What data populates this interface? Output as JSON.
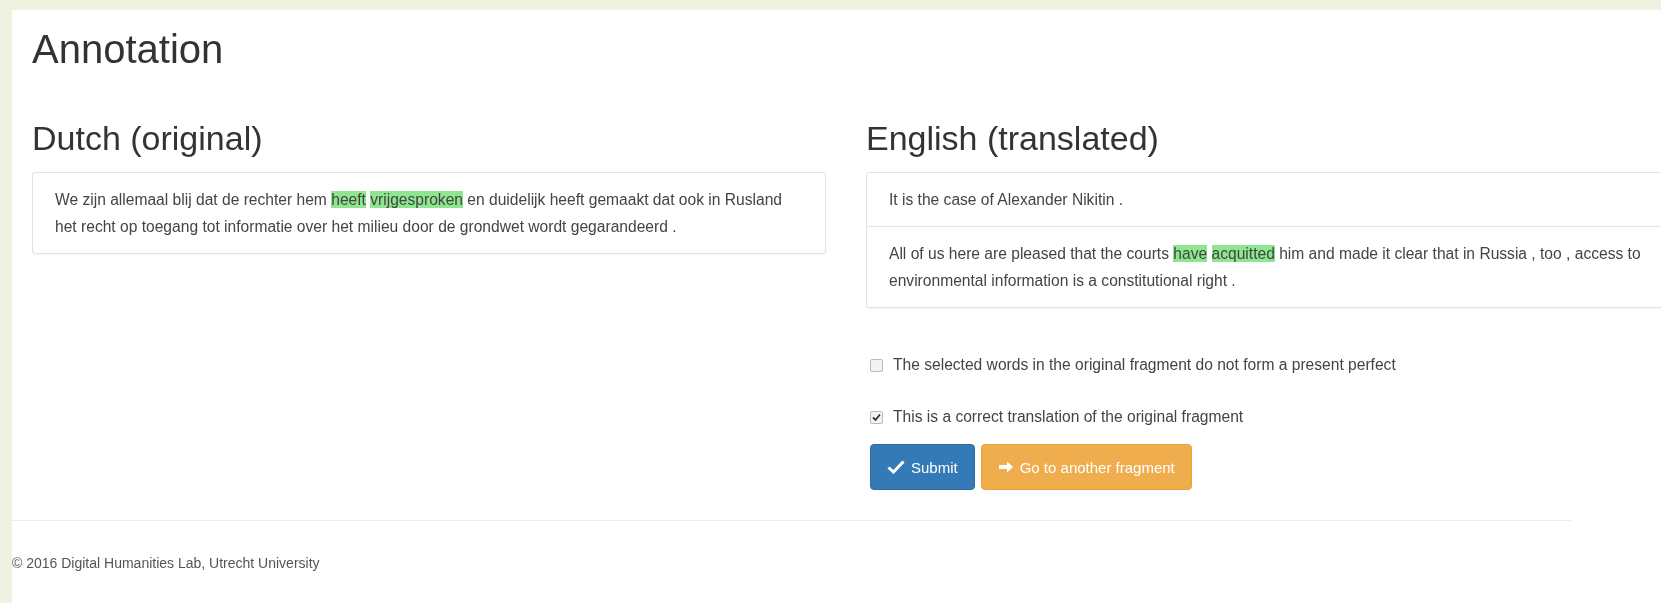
{
  "page": {
    "title": "Annotation"
  },
  "original": {
    "heading": "Dutch (original)",
    "sentences": [
      {
        "chunks": [
          {
            "text": "We zijn allemaal blij dat de rechter hem",
            "highlighted": false
          },
          {
            "text": "heeft",
            "highlighted": true
          },
          {
            "text": "vrijgesproken",
            "highlighted": true
          },
          {
            "text": "en duidelijk heeft gemaakt dat ook in Rusland het recht op toegang tot informatie over het milieu door de grondwet wordt gegarandeerd .",
            "highlighted": false
          }
        ]
      }
    ]
  },
  "translation": {
    "heading": "English (translated)",
    "sentences": [
      {
        "chunks": [
          {
            "text": "It is the case of Alexander Nikitin .",
            "highlighted": false
          }
        ]
      },
      {
        "chunks": [
          {
            "text": "All of us here are pleased that the courts",
            "highlighted": false
          },
          {
            "text": "have",
            "highlighted": true
          },
          {
            "text": "acquitted",
            "highlighted": true
          },
          {
            "text": "him and made it clear that in Russia , too , access to environmental information is a constitutional right .",
            "highlighted": false
          }
        ]
      }
    ]
  },
  "options": [
    {
      "label": "The selected words in the original fragment do not form a present perfect",
      "checked": false
    },
    {
      "label": "This is a correct translation of the original fragment",
      "checked": true
    }
  ],
  "buttons": [
    {
      "label": "Submit",
      "kind": "primary"
    },
    {
      "label": "Go to another fragment",
      "kind": "secondary"
    }
  ],
  "footer": "© 2016 Digital Humanities Lab, Utrecht University"
}
